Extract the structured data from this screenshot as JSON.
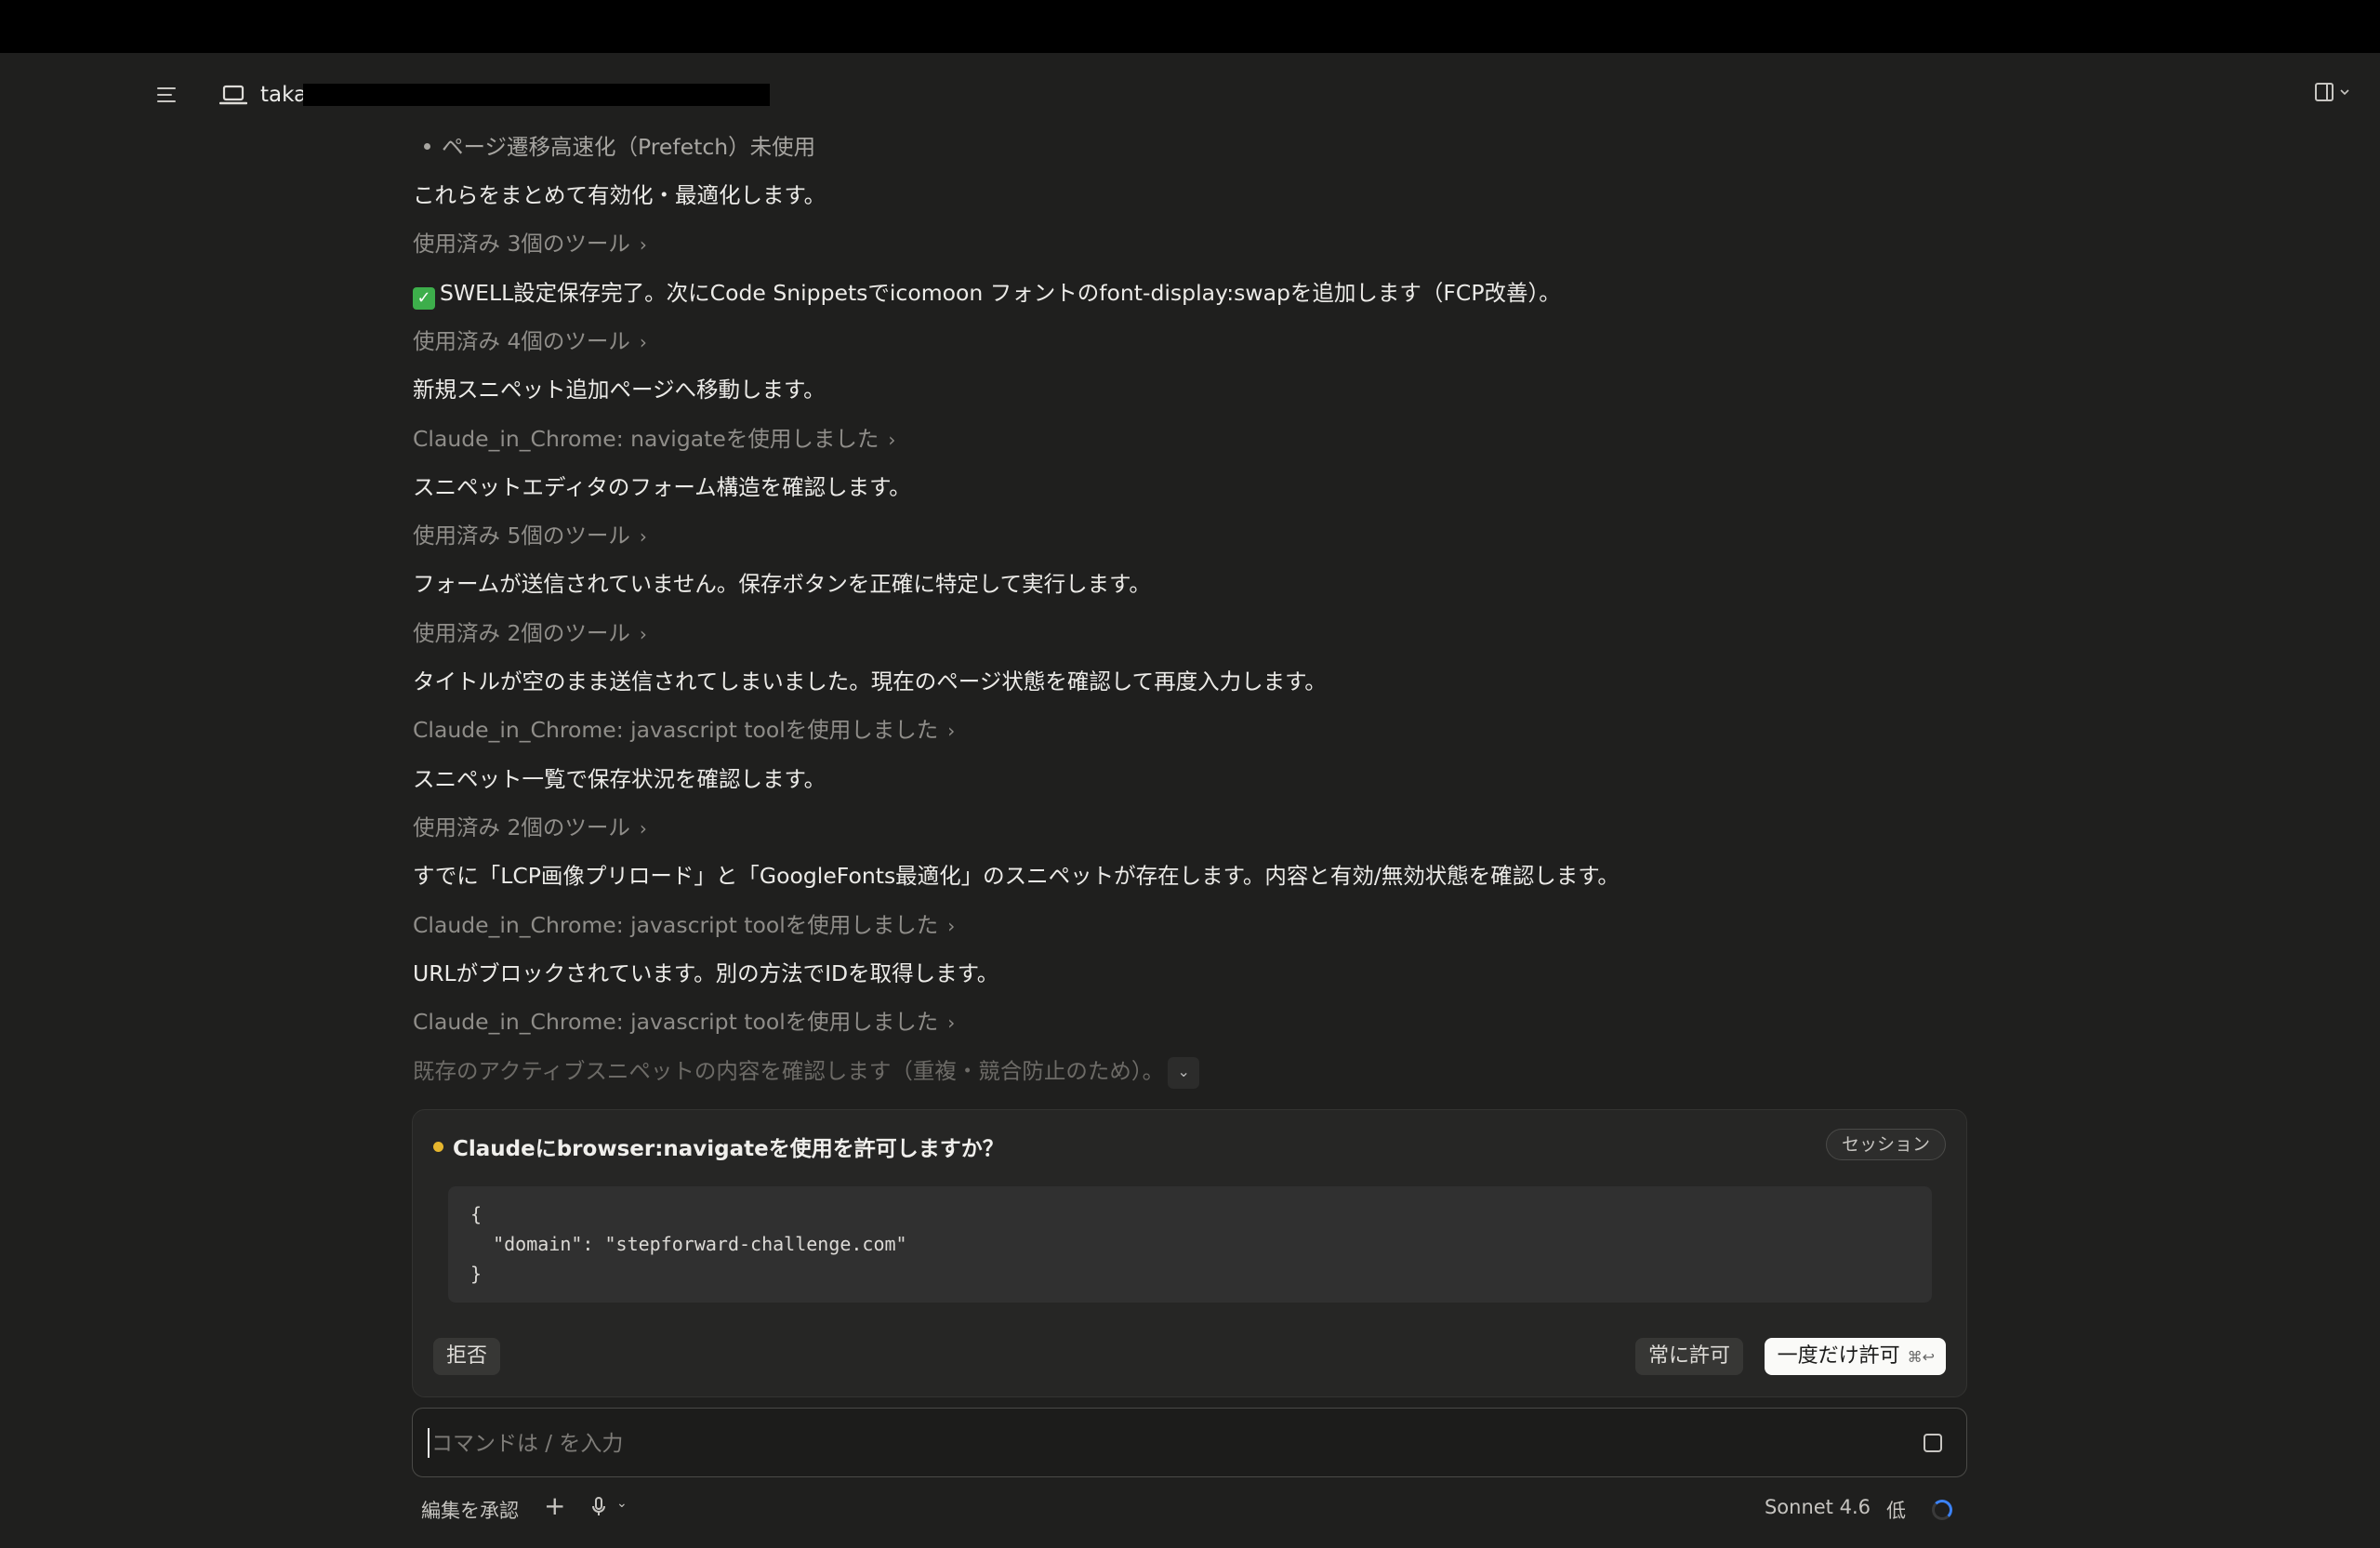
{
  "header": {
    "device_name": "taka"
  },
  "feed": [
    {
      "type": "bullet",
      "text": "ページ遷移高速化（Prefetch）未使用"
    },
    {
      "type": "msg",
      "text": "これらをまとめて有効化・最適化します。"
    },
    {
      "type": "tool",
      "text": "使用済み 3個のツール"
    },
    {
      "type": "msg-check",
      "text": "SWELL設定保存完了。次にCode Snippetsでicomoon フォントのfont-display:swapを追加します（FCP改善）。"
    },
    {
      "type": "tool",
      "text": "使用済み 4個のツール"
    },
    {
      "type": "msg",
      "text": "新規スニペット追加ページへ移動します。"
    },
    {
      "type": "tool",
      "text": "Claude_in_Chrome: navigateを使用しました"
    },
    {
      "type": "msg",
      "text": "スニペットエディタのフォーム構造を確認します。"
    },
    {
      "type": "tool",
      "text": "使用済み 5個のツール"
    },
    {
      "type": "msg",
      "text": "フォームが送信されていません。保存ボタンを正確に特定して実行します。"
    },
    {
      "type": "tool",
      "text": "使用済み 2個のツール"
    },
    {
      "type": "msg",
      "text": "タイトルが空のまま送信されてしまいました。現在のページ状態を確認して再度入力します。"
    },
    {
      "type": "tool",
      "text": "Claude_in_Chrome: javascript toolを使用しました"
    },
    {
      "type": "msg",
      "text": "スニペット一覧で保存状況を確認します。"
    },
    {
      "type": "tool",
      "text": "使用済み 2個のツール"
    },
    {
      "type": "msg",
      "text": "すでに「LCP画像プリロード」と「GoogleFonts最適化」のスニペットが存在します。内容と有効/無効状態を確認します。"
    },
    {
      "type": "tool",
      "text": "Claude_in_Chrome: javascript toolを使用しました"
    },
    {
      "type": "msg",
      "text": "URLがブロックされています。別の方法でIDを取得します。"
    },
    {
      "type": "tool",
      "text": "Claude_in_Chrome: javascript toolを使用しました"
    },
    {
      "type": "faded",
      "text": "既存のアクティブスニペットの内容を確認します（重複・競合防止のため）。"
    }
  ],
  "permission": {
    "title": "Claudeにbrowser:navigateを使用を許可しますか？",
    "session_label": "セッション",
    "code": "{\n  \"domain\": \"stepforward-challenge.com\"\n}",
    "deny_label": "拒否",
    "always_label": "常に許可",
    "once_label": "一度だけ許可",
    "once_shortcut": "⌘↩"
  },
  "input": {
    "placeholder": "コマンドは / を入力"
  },
  "footer": {
    "accept_edits_label": "編集を承認",
    "model_label": "Sonnet 4.6",
    "effort_label": "低"
  }
}
